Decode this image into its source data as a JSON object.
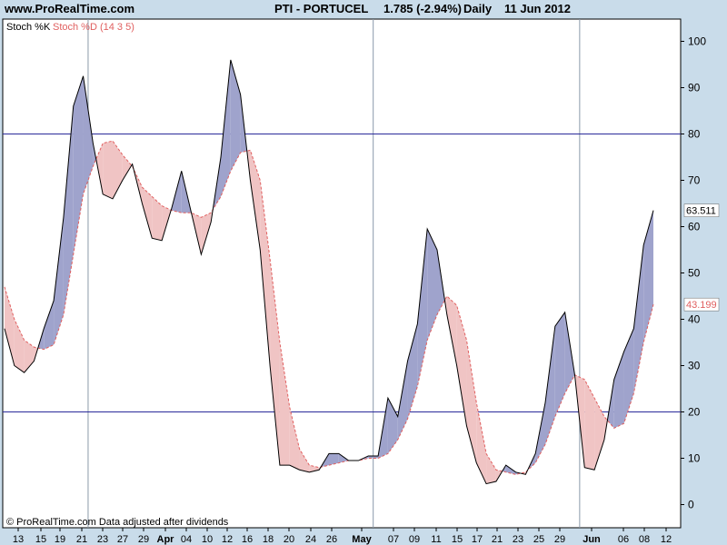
{
  "header": {
    "site": "www.ProRealTime.com",
    "symbol": "PTI - PORTUCEL",
    "price": "1.785 (-2.94%)",
    "period": "Daily",
    "date": "11 Jun 2012"
  },
  "colors": {
    "background": "#c9dcea",
    "plot_bg": "#ffffff",
    "k_line": "#000000",
    "d_line": "#e06060",
    "k_above_fill": "#9fa3cc",
    "d_above_fill": "#f0c4c4",
    "level_line": "#2a2a9a"
  },
  "chart_data": {
    "type": "line",
    "title": "",
    "xlabel": "",
    "ylabel": "",
    "ylim": [
      -3,
      103
    ],
    "y_ticks": [
      0,
      10,
      20,
      30,
      40,
      50,
      60,
      70,
      80,
      90,
      100
    ],
    "levels": [
      20,
      80
    ],
    "x_tick_labels": [
      "13",
      "15",
      "19",
      "21",
      "23",
      "27",
      "29",
      "Apr",
      "04",
      "10",
      "12",
      "16",
      "18",
      "20",
      "24",
      "26",
      "May",
      "07",
      "09",
      "11",
      "15",
      "17",
      "21",
      "23",
      "25",
      "29",
      "Jun",
      "06",
      "08",
      "12"
    ],
    "month_labels": [
      "Apr",
      "May",
      "Jun"
    ],
    "legend": [
      "Stoch %K",
      "Stoch %D (14 3 5)"
    ],
    "series": [
      {
        "name": "Stoch %K",
        "values": [
          38,
          30,
          28.5,
          31,
          38,
          44,
          62,
          86,
          92.5,
          78,
          67,
          66,
          70,
          73.5,
          65,
          57.5,
          57,
          64,
          72,
          63,
          54,
          61,
          75,
          96,
          88.5,
          70,
          55,
          30,
          8.5,
          8.5,
          7.5,
          7,
          7.5,
          11,
          11,
          9.5,
          9.5,
          10.5,
          10.5,
          23,
          19,
          31,
          39,
          59.5,
          55,
          41,
          30,
          17,
          9,
          4.5,
          5,
          8.5,
          7,
          6.5,
          11,
          22,
          38.5,
          41.5,
          28,
          8,
          7.5,
          14,
          27,
          33,
          38,
          56,
          63.5
        ]
      },
      {
        "name": "Stoch %D (14 3 5)",
        "values": [
          47,
          40,
          35.5,
          34,
          33.5,
          34.5,
          41,
          54,
          67,
          73,
          78,
          78.5,
          75.5,
          73,
          68.5,
          66.5,
          64.5,
          63.5,
          63,
          63,
          62,
          63,
          66.5,
          72,
          76,
          76.5,
          70,
          53,
          35,
          21,
          12,
          8.5,
          8,
          8.5,
          9,
          9.5,
          9.5,
          10,
          10,
          11,
          14,
          18.5,
          25.5,
          35.5,
          41,
          45,
          43,
          35.5,
          22,
          11,
          7.5,
          7,
          6.5,
          7,
          9,
          13,
          19,
          24,
          28,
          27,
          23,
          19,
          16.5,
          17.5,
          24,
          35,
          43.2
        ]
      }
    ],
    "last_values": {
      "k": "63.511",
      "d": "43.199"
    },
    "footer": "© ProRealTime.com Data adjusted after dividends"
  }
}
